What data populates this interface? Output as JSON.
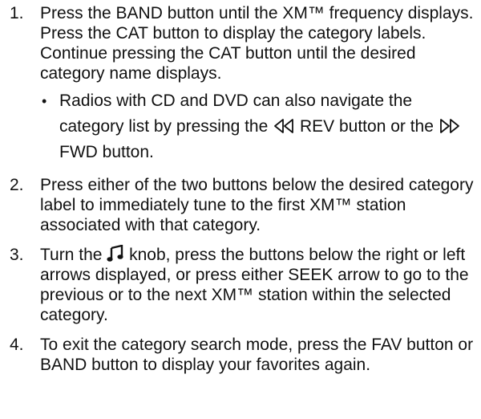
{
  "steps": [
    {
      "number": "1.",
      "text": "Press the BAND button until the XM™ frequency displays. Press the CAT button to display the category labels. Continue pressing the CAT button until the desired category name displays.",
      "bullet": {
        "symbol": "•",
        "part1": "Radios with CD and DVD can also navigate the category list by pressing the ",
        "rev_icon": "rewind-icon",
        "part2": " REV button or the ",
        "fwd_icon": "fast-forward-icon",
        "part3": " FWD button."
      }
    },
    {
      "number": "2.",
      "text": "Press either of the two buttons below the desired category label to immediately tune to the first XM™ station associated with that category."
    },
    {
      "number": "3.",
      "part1": "Turn the ",
      "knob_icon": "music-note-icon",
      "part2": " knob, press the buttons below the right or left arrows displayed, or press either SEEK arrow to go to the previous or to the next XM™ station within the selected category."
    },
    {
      "number": "4.",
      "text": "To exit the category search mode, press the FAV button or BAND button to display your favorites again."
    }
  ]
}
